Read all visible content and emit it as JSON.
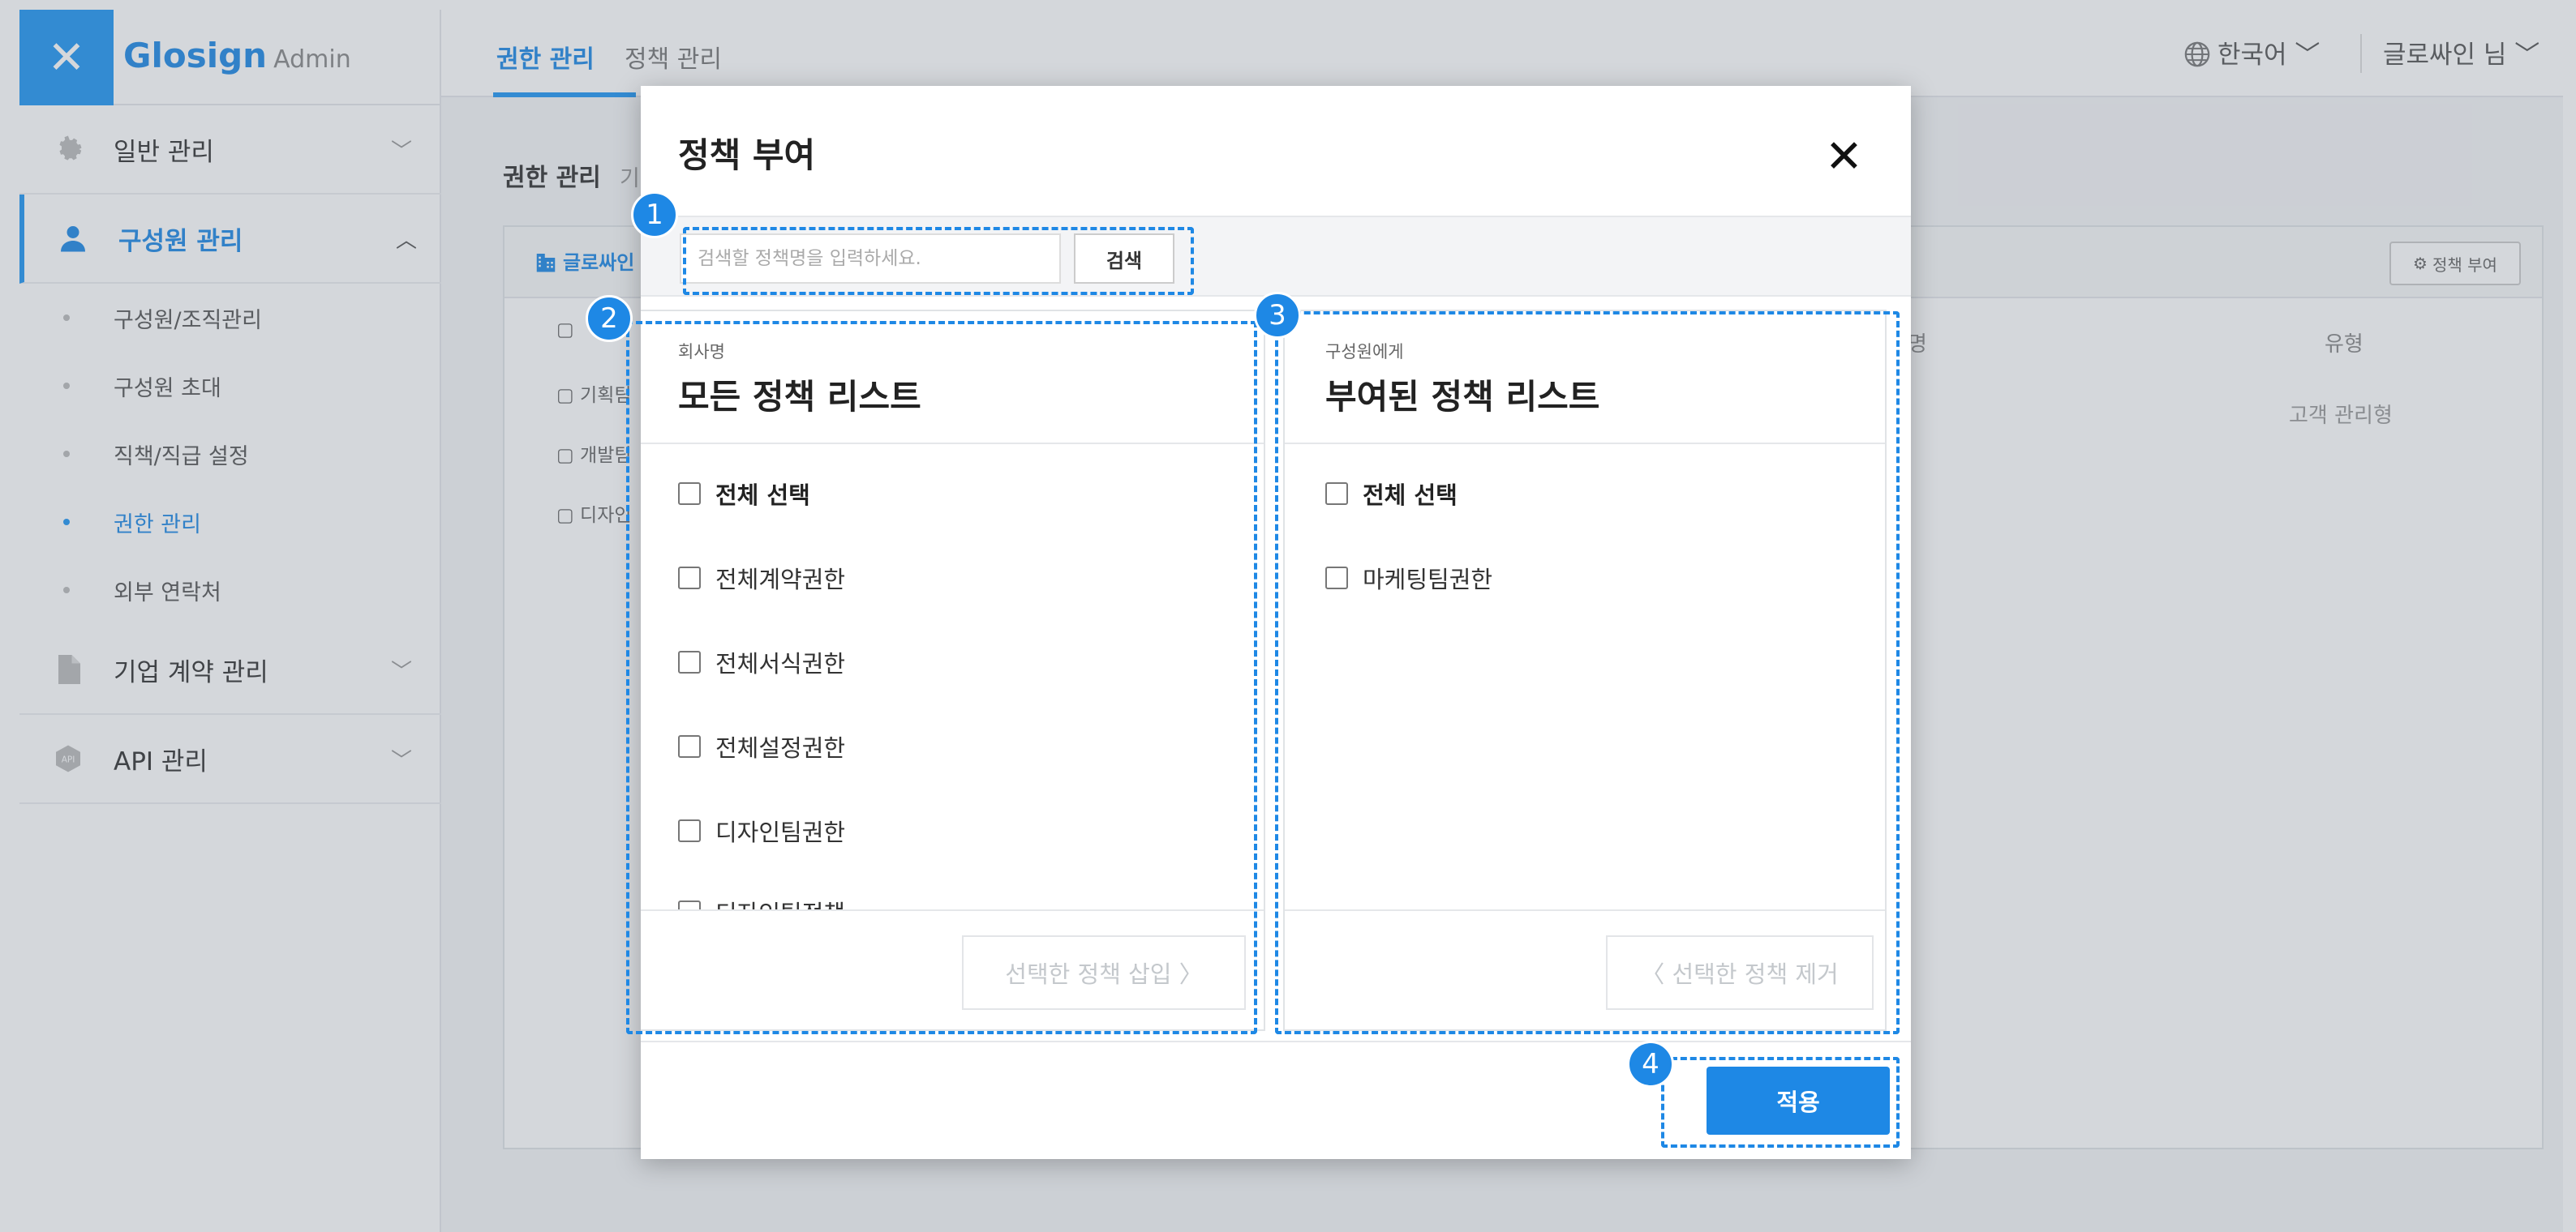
{
  "app": {
    "brand": "Glosign",
    "brand_sub": "Admin",
    "close_glyph": "✕"
  },
  "sidebar": {
    "items": [
      {
        "label": "일반 관리",
        "icon": "gear-icon",
        "chevron": "﹀"
      },
      {
        "label": "구성원 관리",
        "icon": "person-icon",
        "chevron": "︿"
      },
      {
        "label": "기업 계약 관리",
        "icon": "document-icon",
        "chevron": "﹀"
      },
      {
        "label": "API 관리",
        "icon": "api-icon",
        "chevron": "﹀"
      }
    ],
    "sub_items": [
      "구성원/조직관리",
      "구성원 초대",
      "직책/직급 설정",
      "권한 관리",
      "외부 연락처"
    ]
  },
  "topbar": {
    "tabs": [
      "권한 관리",
      "정책 관리"
    ],
    "language": "한국어 ﹀",
    "user": "글로싸인 님 ﹀"
  },
  "background_page": {
    "heading": "권한 관리",
    "heading_sub": "기",
    "tree_root": "글로싸인",
    "tree_items": [
      "",
      "기획팀",
      "개발팀",
      "디자인"
    ],
    "grant_button": "정책 부여",
    "columns": [
      "명",
      "유형"
    ],
    "row_value": "고객 관리형"
  },
  "modal": {
    "title": "정책 부여",
    "close": "✕",
    "search_placeholder": "검색할 정책명을 입력하세요.",
    "search_button": "검색",
    "left_panel": {
      "subtitle": "회사명",
      "title": "모든 정책 리스트",
      "select_all": "전체 선택",
      "items": [
        "전체계약권한",
        "전체서식권한",
        "전체설정권한",
        "디자인팀권한",
        "디자인팀정책"
      ],
      "action": "선택한 정책 삽입  〉"
    },
    "right_panel": {
      "subtitle": "구성원에게",
      "title": "부여된 정책 리스트",
      "select_all": "전체 선택",
      "items": [
        "마케팅팀권한"
      ],
      "action": "〈  선택한 정책 제거"
    },
    "apply_button": "적용"
  },
  "annotations": [
    "1",
    "2",
    "3",
    "4"
  ],
  "colors": {
    "accent": "#1e88e5",
    "overlay": "#646e7d"
  }
}
